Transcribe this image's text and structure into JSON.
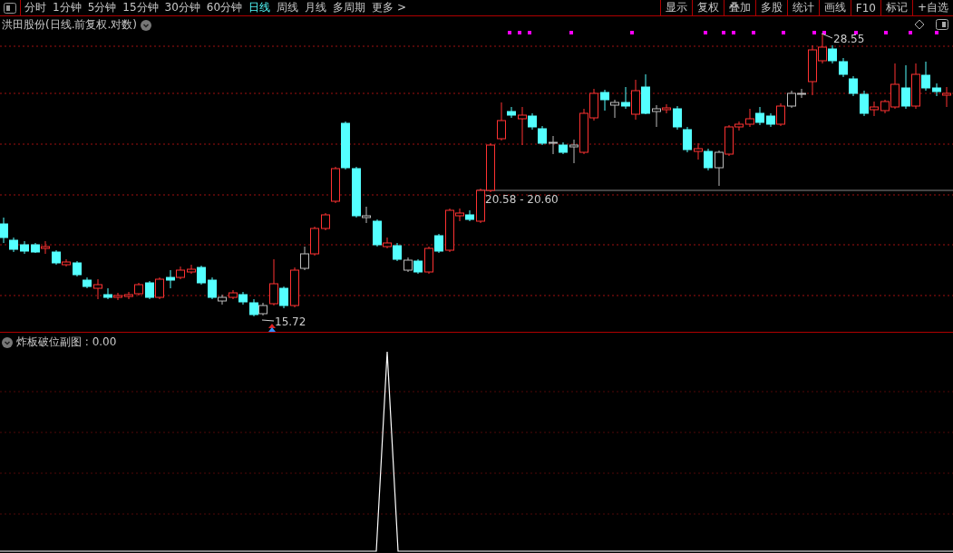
{
  "toolbar": {
    "periods": [
      {
        "label": "分时",
        "selected": false
      },
      {
        "label": "1分钟",
        "selected": false
      },
      {
        "label": "5分钟",
        "selected": false
      },
      {
        "label": "15分钟",
        "selected": false
      },
      {
        "label": "30分钟",
        "selected": false
      },
      {
        "label": "60分钟",
        "selected": false
      },
      {
        "label": "日线",
        "selected": true
      },
      {
        "label": "周线",
        "selected": false
      },
      {
        "label": "月线",
        "selected": false
      },
      {
        "label": "多周期",
        "selected": false
      },
      {
        "label": "更多 >",
        "selected": false
      }
    ],
    "tools": [
      "显示",
      "复权",
      "叠加",
      "多股",
      "统计",
      "画线",
      "F10",
      "标记",
      "+自选"
    ]
  },
  "chart": {
    "title": "洪田股份(日线.前复权.对数)",
    "high_label": "28.55",
    "low_label": "15.72",
    "range_label": "20.58 - 20.60"
  },
  "indicator": {
    "title": "炸板破位副图 : 0.00"
  }
}
